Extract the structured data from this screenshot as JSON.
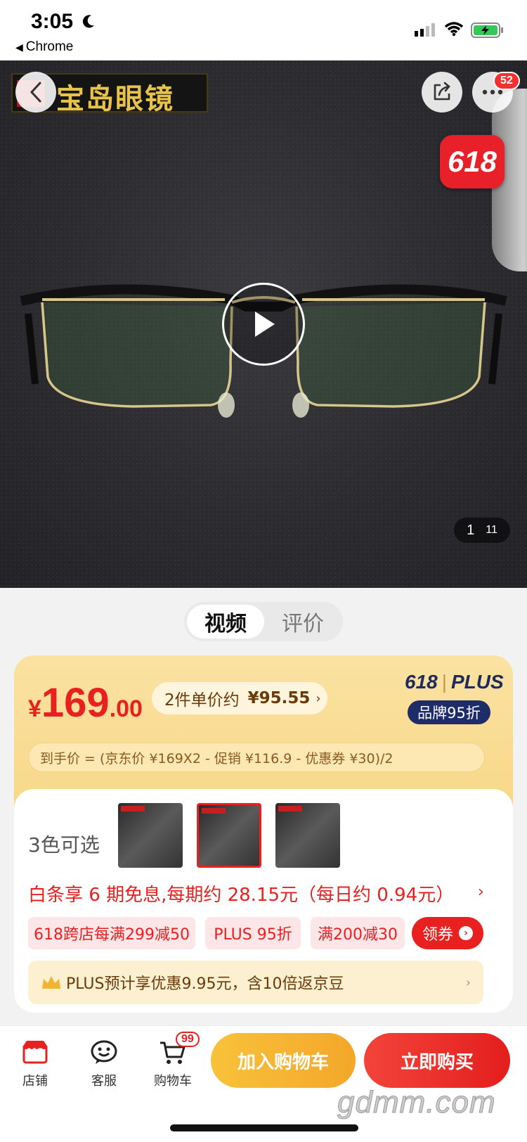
{
  "status_bar": {
    "time": "3:05",
    "back_app": "Chrome"
  },
  "hero": {
    "brand_logo_text": "宝岛眼镜",
    "more_badge": "52",
    "promo_badge": "618",
    "image_index": "1",
    "image_total": "11"
  },
  "tabs": {
    "video": "视频",
    "review": "评价"
  },
  "price": {
    "currency": "¥",
    "integer": "169",
    "decimal": ".00",
    "unit_price_label": "2件单价约",
    "unit_price_value": "¥95.55",
    "plus_logo_618": "618",
    "plus_logo_word": "PLUS",
    "brand_discount": "品牌95折",
    "formula": "到手价 = (京东价 ¥169X2 - 促销 ¥116.9 - 优惠券 ¥30)/2"
  },
  "options": {
    "color_count": "3色可选",
    "baitiao": "白条享 6 期免息,每期约 28.15元（每日约 0.94元）",
    "promos": [
      "618跨店每满299减50",
      "PLUS 95折",
      "满200减30"
    ],
    "coupon_button": "领券",
    "plus_benefit": "PLUS预计享优惠9.95元，含10倍返京豆"
  },
  "bottom_nav": {
    "store": "店铺",
    "service": "客服",
    "cart": "购物车",
    "cart_badge": "99",
    "add_to_cart": "加入购物车",
    "buy_now": "立即购买"
  },
  "watermark": "gdmm.com",
  "colors": {
    "accent_red": "#e8201f",
    "gold": "#f8d98a",
    "plus_navy": "#1e2d6a"
  }
}
